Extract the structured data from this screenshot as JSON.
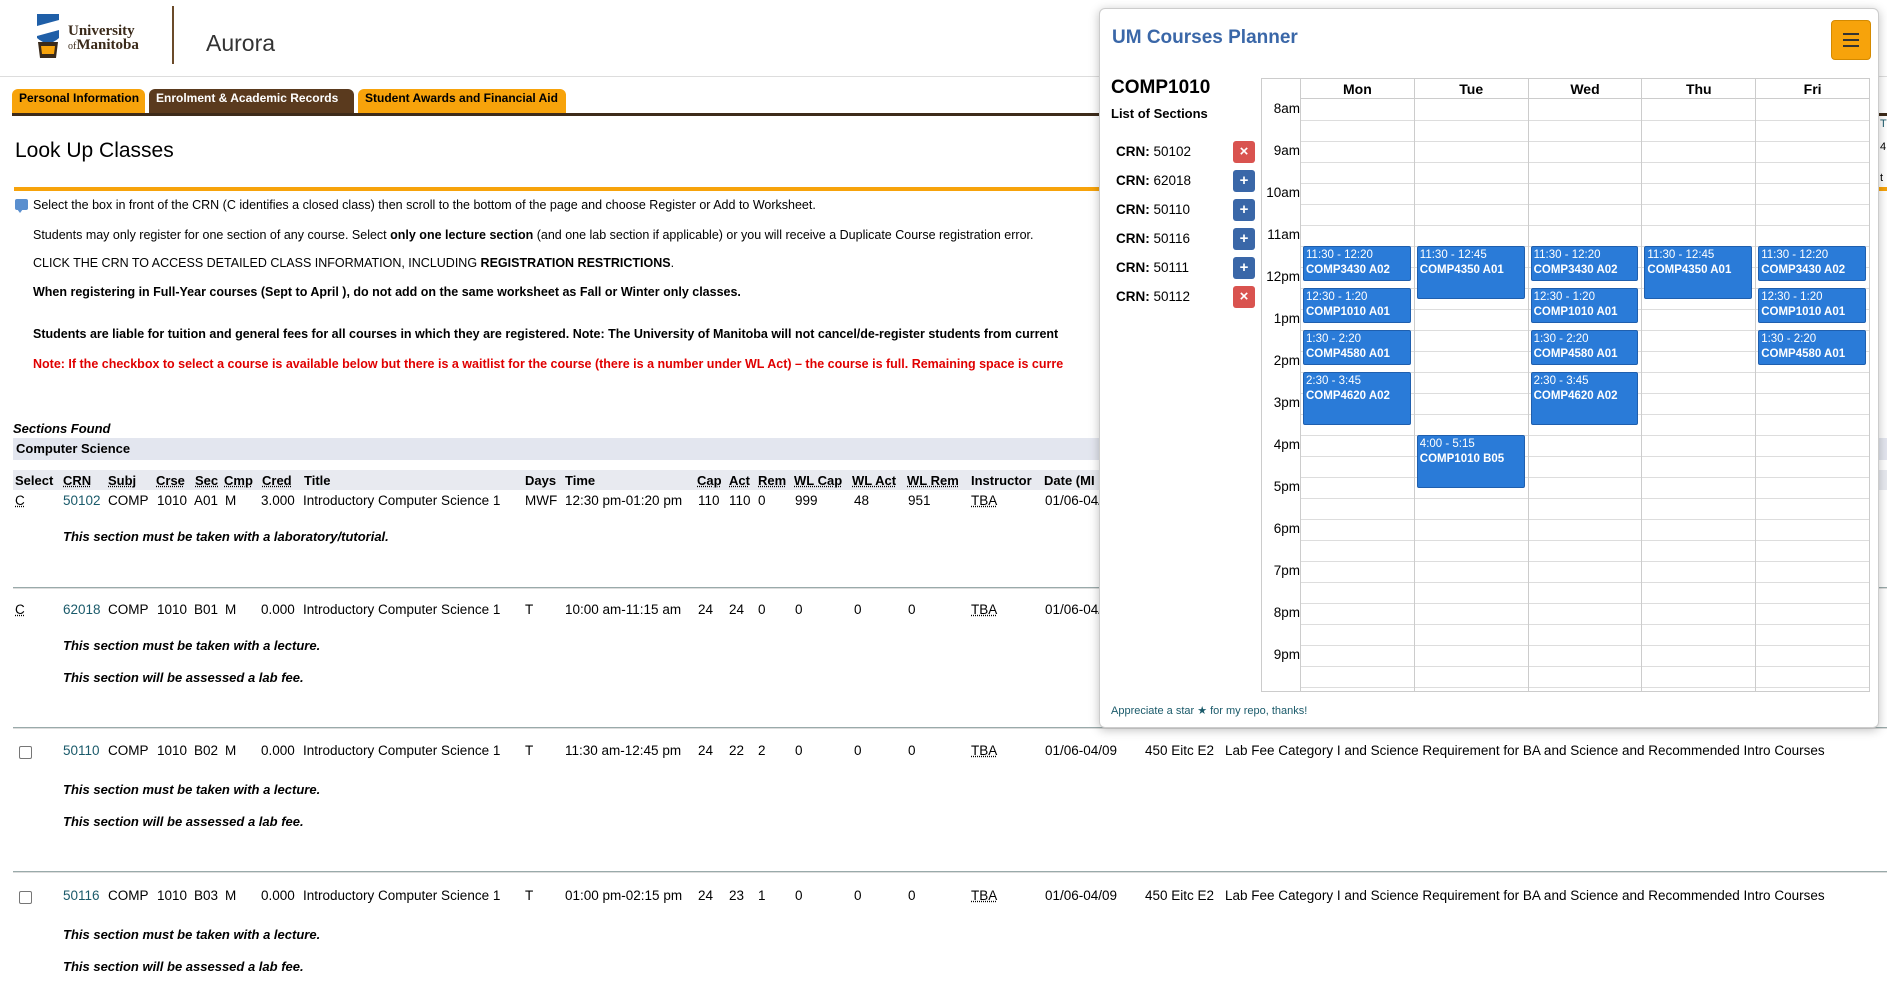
{
  "header": {
    "logo_line1": "University",
    "logo_line2_of": "of",
    "logo_line2": "Manitoba",
    "app_name": "Aurora"
  },
  "tabs": [
    {
      "label": "Personal Information",
      "active": false
    },
    {
      "label": "Enrolment & Academic Records",
      "active": true
    },
    {
      "label": "Student Awards and Financial Aid",
      "active": false
    }
  ],
  "page": {
    "title": "Look Up Classes",
    "instruction": "Select the box in front of the CRN (C identifies a closed class) then scroll to the bottom of the page and choose Register or Add to Worksheet.",
    "note1_a": "Students may only register for one section of any course. Select ",
    "note1_b": "only one lecture section",
    "note1_c": " (and one lab section if applicable) or you will receive a Duplicate Course registration error.",
    "note2_a": "CLICK THE CRN TO ACCESS DETAILED CLASS INFORMATION, INCLUDING ",
    "note2_b": "REGISTRATION RESTRICTIONS",
    "note2_c": ".",
    "note3": "When registering in Full-Year courses (Sept to April ), do not add on the same worksheet as Fall or Winter only classes.",
    "note4": "Students are liable for tuition and general fees for all courses in which they are registered. Note: The University of Manitoba will not cancel/de-register students from current",
    "note5": "Note: If the checkbox to select a course is available below but there is a waitlist for the course (there is a number under WL Act) – the course is full. Remaining space is curre"
  },
  "sections": {
    "found_label": "Sections Found",
    "subject": "Computer Science",
    "columns": [
      "Select",
      "CRN",
      "Subj",
      "Crse",
      "Sec",
      "Cmp",
      "Cred",
      "Title",
      "Days",
      "Time",
      "Cap",
      "Act",
      "Rem",
      "WL Cap",
      "WL Act",
      "WL Rem",
      "Instructor",
      "Date (MI"
    ],
    "rows": [
      {
        "select": "C",
        "crn": "50102",
        "subj": "COMP",
        "crse": "1010",
        "sec": "A01",
        "cmp": "M",
        "cred": "3.000",
        "title": "Introductory Computer Science 1",
        "days": "MWF",
        "time": "12:30 pm-01:20 pm",
        "cap": "110",
        "act": "110",
        "rem": "0",
        "wl_cap": "999",
        "wl_act": "48",
        "wl_rem": "951",
        "instructor": "TBA",
        "date": "01/06-04/",
        "location": "",
        "attribute": "",
        "notes": [
          "This section must be taken with a laboratory/tutorial."
        ]
      },
      {
        "select": "C",
        "crn": "62018",
        "subj": "COMP",
        "crse": "1010",
        "sec": "B01",
        "cmp": "M",
        "cred": "0.000",
        "title": "Introductory Computer Science 1",
        "days": "T",
        "time": "10:00 am-11:15 am",
        "cap": "24",
        "act": "24",
        "rem": "0",
        "wl_cap": "0",
        "wl_act": "0",
        "wl_rem": "0",
        "instructor": "TBA",
        "date": "01/06-04/",
        "location": "",
        "attribute": "",
        "notes": [
          "This section must be taken with a lecture.",
          "This section will be assessed a lab fee."
        ]
      },
      {
        "select": "",
        "crn": "50110",
        "subj": "COMP",
        "crse": "1010",
        "sec": "B02",
        "cmp": "M",
        "cred": "0.000",
        "title": "Introductory Computer Science 1",
        "days": "T",
        "time": "11:30 am-12:45 pm",
        "cap": "24",
        "act": "22",
        "rem": "2",
        "wl_cap": "0",
        "wl_act": "0",
        "wl_rem": "0",
        "instructor": "TBA",
        "date": "01/06-04/09",
        "location": "450 Eitc E2",
        "attribute": "Lab Fee Category I and Science Requirement for BA and Science and Recommended Intro Courses",
        "notes": [
          "This section must be taken with a lecture.",
          "This section will be assessed a lab fee."
        ]
      },
      {
        "select": "",
        "crn": "50116",
        "subj": "COMP",
        "crse": "1010",
        "sec": "B03",
        "cmp": "M",
        "cred": "0.000",
        "title": "Introductory Computer Science 1",
        "days": "T",
        "time": "01:00 pm-02:15 pm",
        "cap": "24",
        "act": "23",
        "rem": "1",
        "wl_cap": "0",
        "wl_act": "0",
        "wl_rem": "0",
        "instructor": "TBA",
        "date": "01/06-04/09",
        "location": "450 Eitc E2",
        "attribute": "Lab Fee Category I and Science Requirement for BA and Science and Recommended Intro Courses",
        "notes": [
          "This section must be taken with a lecture.",
          "This section will be assessed a lab fee."
        ]
      }
    ]
  },
  "planner": {
    "title": "UM Courses Planner",
    "course": "COMP1010",
    "list_title": "List of Sections",
    "crn_label": "CRN:",
    "section_list": [
      {
        "crn": "50102",
        "action": "remove",
        "symbol": "×"
      },
      {
        "crn": "62018",
        "action": "add",
        "symbol": "+"
      },
      {
        "crn": "50110",
        "action": "add",
        "symbol": "+"
      },
      {
        "crn": "50116",
        "action": "add",
        "symbol": "+"
      },
      {
        "crn": "50111",
        "action": "add",
        "symbol": "+"
      },
      {
        "crn": "50112",
        "action": "remove",
        "symbol": "×"
      }
    ],
    "days": [
      "Mon",
      "Tue",
      "Wed",
      "Thu",
      "Fri"
    ],
    "hours": [
      "8am",
      "9am",
      "10am",
      "11am",
      "12pm",
      "1pm",
      "2pm",
      "3pm",
      "4pm",
      "5pm",
      "6pm",
      "7pm",
      "8pm",
      "9pm"
    ],
    "events": [
      {
        "day": 0,
        "start": 11.5,
        "end": 12.33,
        "time": "11:30 - 12:20",
        "code": "COMP3430 A02"
      },
      {
        "day": 0,
        "start": 12.5,
        "end": 13.33,
        "time": "12:30 - 1:20",
        "code": "COMP1010 A01"
      },
      {
        "day": 0,
        "start": 13.5,
        "end": 14.33,
        "time": "1:30 - 2:20",
        "code": "COMP4580 A01"
      },
      {
        "day": 0,
        "start": 14.5,
        "end": 15.75,
        "time": "2:30 - 3:45",
        "code": "COMP4620 A02"
      },
      {
        "day": 1,
        "start": 11.5,
        "end": 12.75,
        "time": "11:30 - 12:45",
        "code": "COMP4350 A01"
      },
      {
        "day": 1,
        "start": 16.0,
        "end": 17.25,
        "time": "4:00 - 5:15",
        "code": "COMP1010 B05"
      },
      {
        "day": 2,
        "start": 11.5,
        "end": 12.33,
        "time": "11:30 - 12:20",
        "code": "COMP3430 A02"
      },
      {
        "day": 2,
        "start": 12.5,
        "end": 13.33,
        "time": "12:30 - 1:20",
        "code": "COMP1010 A01"
      },
      {
        "day": 2,
        "start": 13.5,
        "end": 14.33,
        "time": "1:30 - 2:20",
        "code": "COMP4580 A01"
      },
      {
        "day": 2,
        "start": 14.5,
        "end": 15.75,
        "time": "2:30 - 3:45",
        "code": "COMP4620 A02"
      },
      {
        "day": 3,
        "start": 11.5,
        "end": 12.75,
        "time": "11:30 - 12:45",
        "code": "COMP4350 A01"
      },
      {
        "day": 4,
        "start": 11.5,
        "end": 12.33,
        "time": "11:30 - 12:20",
        "code": "COMP3430 A02"
      },
      {
        "day": 4,
        "start": 12.5,
        "end": 13.33,
        "time": "12:30 - 1:20",
        "code": "COMP1010 A01"
      },
      {
        "day": 4,
        "start": 13.5,
        "end": 14.33,
        "time": "1:30 - 2:20",
        "code": "COMP4580 A01"
      }
    ],
    "footer": "Appreciate a star ★ for my repo, thanks!"
  },
  "edge_fragments": [
    "T",
    "4",
    "t"
  ],
  "colors": {
    "accent": "#f7a30b",
    "brown": "#5a3a1e",
    "event": "#2a7bd8",
    "planner_title": "#3a67a8",
    "remove": "#d9534f",
    "add": "#3a67a8",
    "link": "#1a5a6a"
  }
}
